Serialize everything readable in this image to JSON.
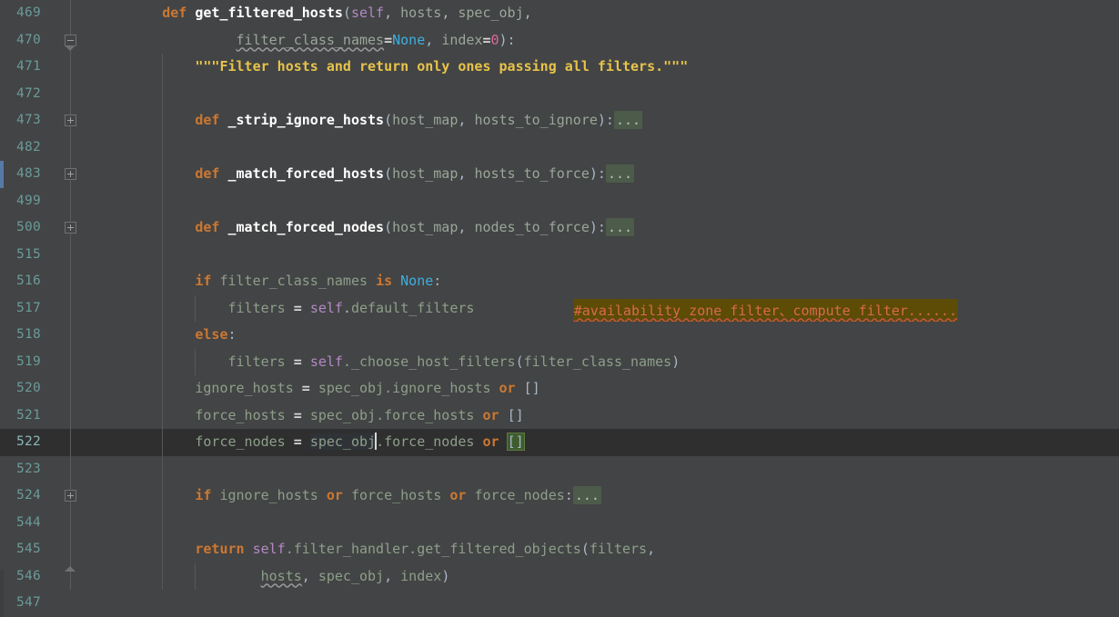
{
  "editor": {
    "theme": "darcula",
    "language": "python",
    "colors": {
      "background": "#434445",
      "caret_row": "#2f2f2f",
      "line_number": "#6a9a9a",
      "keyword": "#cc7832",
      "function_name": "#ffffff",
      "self_keyword": "#b389c5",
      "identifier": "#8d9f8a",
      "number": "#d96a9a",
      "constant": "#3daee0",
      "docstring": "#e7c34a",
      "comment": "#d9694c",
      "comment_highlight_bg": "#5c4c06",
      "collapsed_chip_bg": "#4d5b4a",
      "brace_match_bg": "#3f5c2f",
      "selection_bg": "#2f3337",
      "vcs_changed": "#5679a5"
    },
    "lines": [
      {
        "number": "469",
        "fold": "region-start",
        "guides": 0,
        "current": false,
        "tokens": [
          {
            "t": "        ",
            "c": "plain"
          },
          {
            "t": "def ",
            "c": "kw"
          },
          {
            "t": "get_filtered_hosts",
            "c": "fn"
          },
          {
            "t": "(",
            "c": "punct"
          },
          {
            "t": "self",
            "c": "self"
          },
          {
            "t": ", ",
            "c": "punct"
          },
          {
            "t": "hosts",
            "c": "param"
          },
          {
            "t": ", ",
            "c": "punct"
          },
          {
            "t": "spec_obj",
            "c": "param"
          },
          {
            "t": ",",
            "c": "punct"
          }
        ]
      },
      {
        "number": "470",
        "fold": "region-end-arrow",
        "guides": 0,
        "current": false,
        "tokens": [
          {
            "t": "                 ",
            "c": "plain"
          },
          {
            "t": "filter_class_names",
            "c": "param squig"
          },
          {
            "t": "=",
            "c": "op"
          },
          {
            "t": "None",
            "c": "const"
          },
          {
            "t": ", ",
            "c": "punct"
          },
          {
            "t": "index",
            "c": "param"
          },
          {
            "t": "=",
            "c": "op"
          },
          {
            "t": "0",
            "c": "num"
          },
          {
            "t": "):",
            "c": "punct"
          }
        ]
      },
      {
        "number": "471",
        "fold": "none",
        "guides": 1,
        "current": false,
        "tokens": [
          {
            "t": "            ",
            "c": "plain"
          },
          {
            "t": "\"\"\"Filter hosts and return only ones passing all filters.\"\"\"",
            "c": "str"
          }
        ]
      },
      {
        "number": "472",
        "fold": "none",
        "guides": 1,
        "current": false,
        "tokens": []
      },
      {
        "number": "473",
        "fold": "collapsed",
        "guides": 1,
        "current": false,
        "tokens": [
          {
            "t": "            ",
            "c": "plain"
          },
          {
            "t": "def ",
            "c": "kw"
          },
          {
            "t": "_strip_ignore_hosts",
            "c": "fn"
          },
          {
            "t": "(",
            "c": "punct"
          },
          {
            "t": "host_map",
            "c": "param"
          },
          {
            "t": ", ",
            "c": "punct"
          },
          {
            "t": "hosts_to_ignore",
            "c": "param"
          },
          {
            "t": "):",
            "c": "punct"
          },
          {
            "t": "...",
            "c": "ellipsis"
          }
        ]
      },
      {
        "number": "482",
        "fold": "none",
        "guides": 1,
        "current": false,
        "tokens": []
      },
      {
        "number": "483",
        "fold": "collapsed",
        "guides": 1,
        "current": false,
        "vcs": "changed",
        "tokens": [
          {
            "t": "            ",
            "c": "plain"
          },
          {
            "t": "def ",
            "c": "kw"
          },
          {
            "t": "_match_forced_hosts",
            "c": "fn"
          },
          {
            "t": "(",
            "c": "punct"
          },
          {
            "t": "host_map",
            "c": "param"
          },
          {
            "t": ", ",
            "c": "punct"
          },
          {
            "t": "hosts_to_force",
            "c": "param"
          },
          {
            "t": "):",
            "c": "punct"
          },
          {
            "t": "...",
            "c": "ellipsis"
          }
        ]
      },
      {
        "number": "499",
        "fold": "none",
        "guides": 1,
        "current": false,
        "tokens": []
      },
      {
        "number": "500",
        "fold": "collapsed",
        "guides": 1,
        "current": false,
        "tokens": [
          {
            "t": "            ",
            "c": "plain"
          },
          {
            "t": "def ",
            "c": "kw"
          },
          {
            "t": "_match_forced_nodes",
            "c": "fn"
          },
          {
            "t": "(",
            "c": "punct"
          },
          {
            "t": "host_map",
            "c": "param"
          },
          {
            "t": ", ",
            "c": "punct"
          },
          {
            "t": "nodes_to_force",
            "c": "param"
          },
          {
            "t": "):",
            "c": "punct"
          },
          {
            "t": "...",
            "c": "ellipsis"
          }
        ]
      },
      {
        "number": "515",
        "fold": "none",
        "guides": 1,
        "current": false,
        "tokens": []
      },
      {
        "number": "516",
        "fold": "none",
        "guides": 1,
        "current": false,
        "tokens": [
          {
            "t": "            ",
            "c": "plain"
          },
          {
            "t": "if ",
            "c": "kw"
          },
          {
            "t": "filter_class_names ",
            "c": "ident"
          },
          {
            "t": "is ",
            "c": "kw"
          },
          {
            "t": "None",
            "c": "const"
          },
          {
            "t": ":",
            "c": "punct"
          }
        ]
      },
      {
        "number": "517",
        "fold": "none",
        "guides": 2,
        "current": false,
        "comment": {
          "text": "#availability zone filter、compute filter......",
          "highlighted": true,
          "column": 58
        },
        "tokens": [
          {
            "t": "                ",
            "c": "plain"
          },
          {
            "t": "filters ",
            "c": "ident"
          },
          {
            "t": "= ",
            "c": "op"
          },
          {
            "t": "self",
            "c": "self"
          },
          {
            "t": ".",
            "c": "punct"
          },
          {
            "t": "default_filters",
            "c": "ident"
          }
        ]
      },
      {
        "number": "518",
        "fold": "none",
        "guides": 1,
        "current": false,
        "tokens": [
          {
            "t": "            ",
            "c": "plain"
          },
          {
            "t": "else",
            "c": "kw"
          },
          {
            "t": ":",
            "c": "punct"
          }
        ]
      },
      {
        "number": "519",
        "fold": "none",
        "guides": 2,
        "current": false,
        "tokens": [
          {
            "t": "                ",
            "c": "plain"
          },
          {
            "t": "filters ",
            "c": "ident"
          },
          {
            "t": "= ",
            "c": "op"
          },
          {
            "t": "self",
            "c": "self"
          },
          {
            "t": "._choose_host_filters",
            "c": "ident"
          },
          {
            "t": "(",
            "c": "punct"
          },
          {
            "t": "filter_class_names",
            "c": "ident"
          },
          {
            "t": ")",
            "c": "punct"
          }
        ]
      },
      {
        "number": "520",
        "fold": "none",
        "guides": 1,
        "current": false,
        "tokens": [
          {
            "t": "            ",
            "c": "plain"
          },
          {
            "t": "ignore_hosts ",
            "c": "ident"
          },
          {
            "t": "= ",
            "c": "op"
          },
          {
            "t": "spec_obj",
            "c": "ident"
          },
          {
            "t": ".ignore_hosts ",
            "c": "ident"
          },
          {
            "t": "or ",
            "c": "kw"
          },
          {
            "t": "[]",
            "c": "punct"
          }
        ]
      },
      {
        "number": "521",
        "fold": "none",
        "guides": 1,
        "current": false,
        "tokens": [
          {
            "t": "            ",
            "c": "plain"
          },
          {
            "t": "force_hosts ",
            "c": "ident"
          },
          {
            "t": "= ",
            "c": "op"
          },
          {
            "t": "spec_obj",
            "c": "ident"
          },
          {
            "t": ".force_hosts ",
            "c": "ident"
          },
          {
            "t": "or ",
            "c": "kw"
          },
          {
            "t": "[]",
            "c": "punct"
          }
        ]
      },
      {
        "number": "522",
        "fold": "none",
        "guides": 1,
        "current": true,
        "tokens": [
          {
            "t": "            ",
            "c": "plain"
          },
          {
            "t": "force_nodes ",
            "c": "ident"
          },
          {
            "t": "= ",
            "c": "op"
          },
          {
            "t": "spec_obj",
            "c": "ident sel"
          },
          {
            "t": "|CARET|",
            "c": "caret"
          },
          {
            "t": ".force_nodes ",
            "c": "ident"
          },
          {
            "t": "or ",
            "c": "kw"
          },
          {
            "t": "[]",
            "c": "punct brace-hl"
          }
        ]
      },
      {
        "number": "523",
        "fold": "none",
        "guides": 1,
        "current": false,
        "tokens": []
      },
      {
        "number": "524",
        "fold": "collapsed",
        "guides": 1,
        "current": false,
        "tokens": [
          {
            "t": "            ",
            "c": "plain"
          },
          {
            "t": "if ",
            "c": "kw"
          },
          {
            "t": "ignore_hosts ",
            "c": "ident"
          },
          {
            "t": "or ",
            "c": "kw"
          },
          {
            "t": "force_hosts ",
            "c": "ident"
          },
          {
            "t": "or ",
            "c": "kw"
          },
          {
            "t": "force_nodes",
            "c": "ident"
          },
          {
            "t": ":",
            "c": "punct"
          },
          {
            "t": "...",
            "c": "ellipsis"
          }
        ]
      },
      {
        "number": "544",
        "fold": "none",
        "guides": 1,
        "current": false,
        "tokens": []
      },
      {
        "number": "545",
        "fold": "none",
        "guides": 1,
        "current": false,
        "tokens": [
          {
            "t": "            ",
            "c": "plain"
          },
          {
            "t": "return ",
            "c": "kw"
          },
          {
            "t": "self",
            "c": "self"
          },
          {
            "t": ".filter_handler.get_filtered_objects",
            "c": "ident"
          },
          {
            "t": "(",
            "c": "punct"
          },
          {
            "t": "filters",
            "c": "ident"
          },
          {
            "t": ",",
            "c": "punct"
          }
        ]
      },
      {
        "number": "546",
        "fold": "region-end-up",
        "guides": 2,
        "current": false,
        "tokens": [
          {
            "t": "                    ",
            "c": "plain"
          },
          {
            "t": "hosts",
            "c": "ident squig"
          },
          {
            "t": ", ",
            "c": "punct"
          },
          {
            "t": "spec_obj",
            "c": "ident"
          },
          {
            "t": ", ",
            "c": "punct"
          },
          {
            "t": "index",
            "c": "ident"
          },
          {
            "t": ")",
            "c": "punct"
          }
        ]
      },
      {
        "number": "547",
        "fold": "none",
        "guides": 0,
        "current": false,
        "tokens": []
      }
    ]
  }
}
